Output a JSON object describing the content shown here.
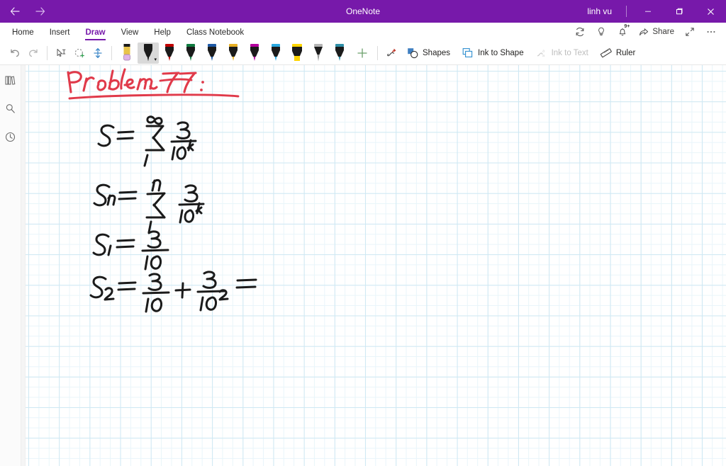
{
  "window": {
    "app_title": "OneNote",
    "account_name": "linh vu",
    "back_label": "Back",
    "forward_label": "Forward",
    "minimize_label": "Minimize",
    "restore_label": "Restore Down",
    "close_label": "Close",
    "titlebar_color": "#7719AA"
  },
  "ribbon": {
    "tabs": [
      {
        "label": "Home",
        "active": false
      },
      {
        "label": "Insert",
        "active": false
      },
      {
        "label": "Draw",
        "active": true
      },
      {
        "label": "View",
        "active": false
      },
      {
        "label": "Help",
        "active": false
      },
      {
        "label": "Class Notebook",
        "active": false
      }
    ],
    "right_actions": [
      {
        "label": "Sync",
        "icon": "sync-icon"
      },
      {
        "label": "Tell me what you want to do",
        "icon": "lightbulb-icon"
      },
      {
        "label": "Notifications",
        "icon": "bell-icon",
        "badge": "9+"
      },
      {
        "label": "Share",
        "icon": "share-icon"
      },
      {
        "label": "Full screen",
        "icon": "expand-icon"
      },
      {
        "label": "More options",
        "icon": "ellipsis-icon"
      }
    ],
    "share_label": "Share",
    "notification_badge": "9+"
  },
  "toolbar": {
    "undo_label": "Undo",
    "redo_label": "Redo",
    "lasso_text_label": "Select text",
    "lasso_select_label": "Lasso Select",
    "insert_space_label": "Insert Space",
    "eraser_label": "Eraser",
    "add_pen_label": "Add Pen",
    "pens": [
      {
        "name": "black-pen",
        "color": "#1b1b1b",
        "type": "pen",
        "selected": true
      },
      {
        "name": "red-pen",
        "color": "#c00000",
        "type": "pen",
        "selected": false
      },
      {
        "name": "green-pen",
        "color": "#107c41",
        "type": "pen",
        "selected": false
      },
      {
        "name": "blue-pen",
        "color": "#1f5aa6",
        "type": "pen",
        "selected": false
      },
      {
        "name": "gold-pen",
        "color": "#e8b024",
        "type": "pen",
        "selected": false
      },
      {
        "name": "magenta-pen",
        "color": "#b4009e",
        "type": "pen",
        "selected": false
      },
      {
        "name": "cyan-pen",
        "color": "#2aa8e0",
        "type": "pen",
        "selected": false
      },
      {
        "name": "yellow-highlighter",
        "color": "#ffd500",
        "type": "highlighter",
        "selected": false
      },
      {
        "name": "silver-pencil",
        "color": "#9a9a9a",
        "type": "pencil",
        "selected": false
      },
      {
        "name": "teal-pen",
        "color": "#2f8fa8",
        "type": "pen",
        "selected": false
      }
    ],
    "actions": [
      {
        "label": "Ink Replay",
        "icon": "ink-replay-icon",
        "disabled": false,
        "show_label": false
      },
      {
        "label": "Shapes",
        "icon": "shapes-icon",
        "disabled": false,
        "show_label": true
      },
      {
        "label": "Ink to Shape",
        "icon": "ink-to-shape-icon",
        "disabled": false,
        "show_label": true
      },
      {
        "label": "Ink to Text",
        "icon": "ink-to-text-icon",
        "disabled": true,
        "show_label": true
      },
      {
        "label": "Ruler",
        "icon": "ruler-icon",
        "disabled": false,
        "show_label": true
      }
    ],
    "shapes_label": "Shapes",
    "ink_to_shape_label": "Ink to Shape",
    "ink_to_text_label": "Ink to Text",
    "ruler_label": "Ruler"
  },
  "left_rail": {
    "items": [
      {
        "label": "Notebooks",
        "icon": "notebooks-icon"
      },
      {
        "label": "Search",
        "icon": "search-icon"
      },
      {
        "label": "Recent Notes",
        "icon": "clock-icon"
      }
    ]
  },
  "page": {
    "grid": "small squares",
    "grid_color": "#cfe8f3",
    "ink_notes": [
      {
        "name": "problem-heading",
        "color": "#e03a4a",
        "text": "Problem 77:",
        "underlined": true
      },
      {
        "name": "equation-series-infinite",
        "color": "#1b1b1b",
        "text": "S = sum from 1 to infinity of 3/10^k"
      },
      {
        "name": "equation-partial-sum-n",
        "color": "#1b1b1b",
        "text": "S_n = sum from 1 to n of 3/10^k"
      },
      {
        "name": "equation-s1",
        "color": "#1b1b1b",
        "text": "S_1 = 3/10"
      },
      {
        "name": "equation-s2",
        "color": "#1b1b1b",
        "text": "S_2 = 3/10 + 3/10^2 ="
      }
    ]
  }
}
